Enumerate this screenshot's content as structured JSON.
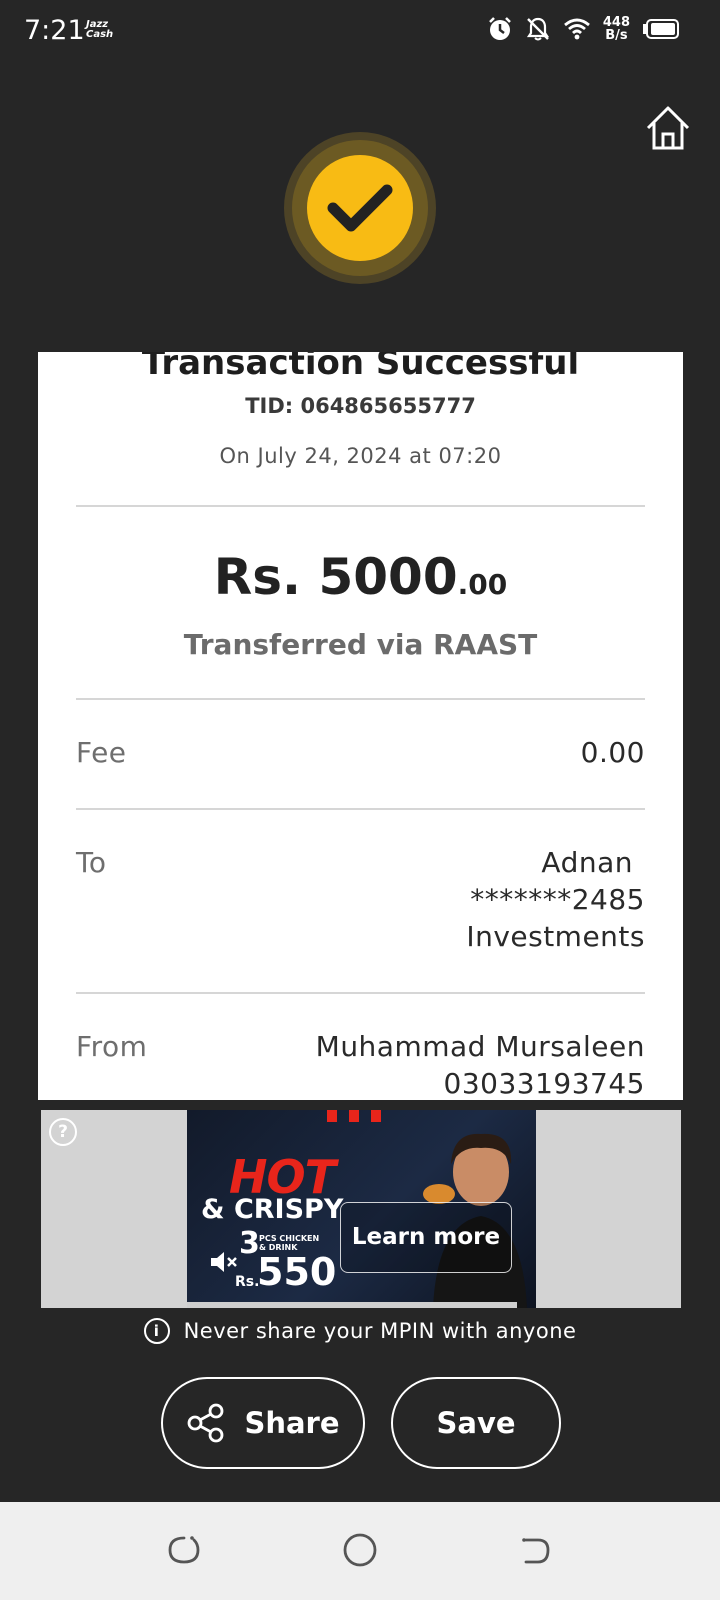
{
  "status_bar": {
    "time": "7:21",
    "jazz_top": "Jazz",
    "jazz_bottom": "Cash",
    "speed_top": "448",
    "speed_bottom": "B/s"
  },
  "receipt": {
    "title": "Transaction Successful",
    "tid": "TID: 064865655777",
    "date": "On July 24, 2024 at 07:20",
    "amount_main": "Rs. 5000",
    "amount_decimal": ".00",
    "via": "Transferred via RAAST",
    "fee_label": "Fee",
    "fee_value": "0.00",
    "to_label": "To",
    "to_name": "Adnan",
    "to_account": "*******2485",
    "to_bank": "Investments",
    "from_label": "From",
    "from_name": "Muhammad Mursaleen",
    "from_account": "03033193745"
  },
  "ad": {
    "help": "?",
    "hot": "HOT",
    "crispy": "& CRISPY",
    "three": "3",
    "pcs_line1": "PCS CHICKEN",
    "pcs_line2": "& DRINK",
    "rs": "Rs.",
    "price": "550",
    "learn_more": "Learn more"
  },
  "warning": {
    "icon": "i",
    "text": "Never share your MPIN with anyone"
  },
  "actions": {
    "share_label": "Share",
    "save_label": "Save"
  },
  "colors": {
    "background": "#262626",
    "accent": "#f8bb14",
    "card": "#ffffff"
  }
}
